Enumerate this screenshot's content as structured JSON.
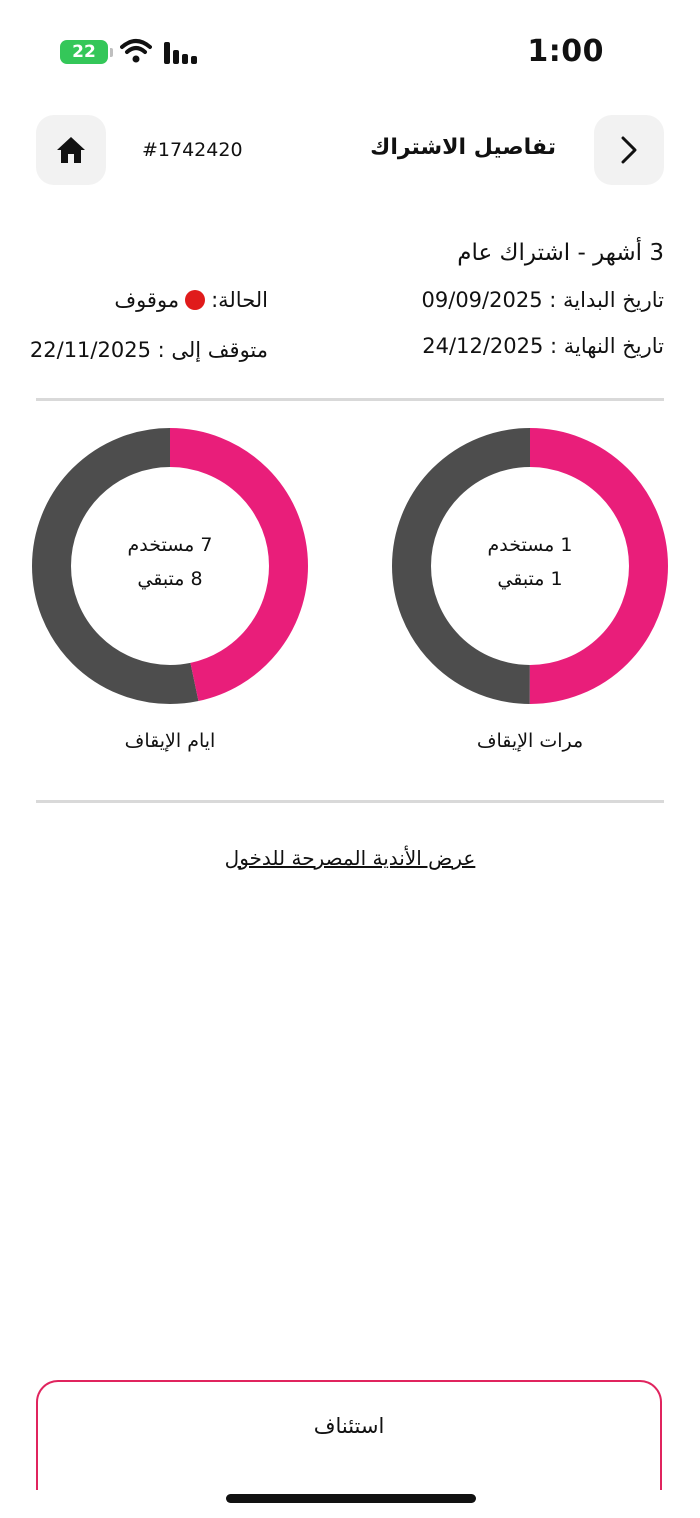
{
  "status_bar": {
    "time": "1:00",
    "battery": "22"
  },
  "header": {
    "subscription_id": "#1742420",
    "title": "تفاصيل الاشتراك"
  },
  "subscription": {
    "plan": "3 أشهر - اشتراك عام",
    "start_date_label": "تاريخ البداية :",
    "start_date": "09/09/2025",
    "end_date_label": "تاريخ النهاية :",
    "end_date": "24/12/2025",
    "status_label": "الحالة:",
    "status_value": "موقوف",
    "paused_until_label": "متوقف إلى :",
    "paused_until": "22/11/2025"
  },
  "charts": [
    {
      "title": "مرات الإيقاف",
      "used_text": "1 مستخدم",
      "remaining_text": "1 متبقي",
      "used": 1,
      "remaining": 1
    },
    {
      "title": "ايام الإيقاف",
      "used_text": "7 مستخدم",
      "remaining_text": "8 متبقي",
      "used": 7,
      "remaining": 8
    }
  ],
  "colors": {
    "used": "#e91e7a",
    "remaining": "#4d4d4d",
    "status_dot": "#e01b1b"
  },
  "links": {
    "allowed_clubs": "عرض الأندية المصرحة للدخول"
  },
  "actions": {
    "resume": "استئناف"
  }
}
